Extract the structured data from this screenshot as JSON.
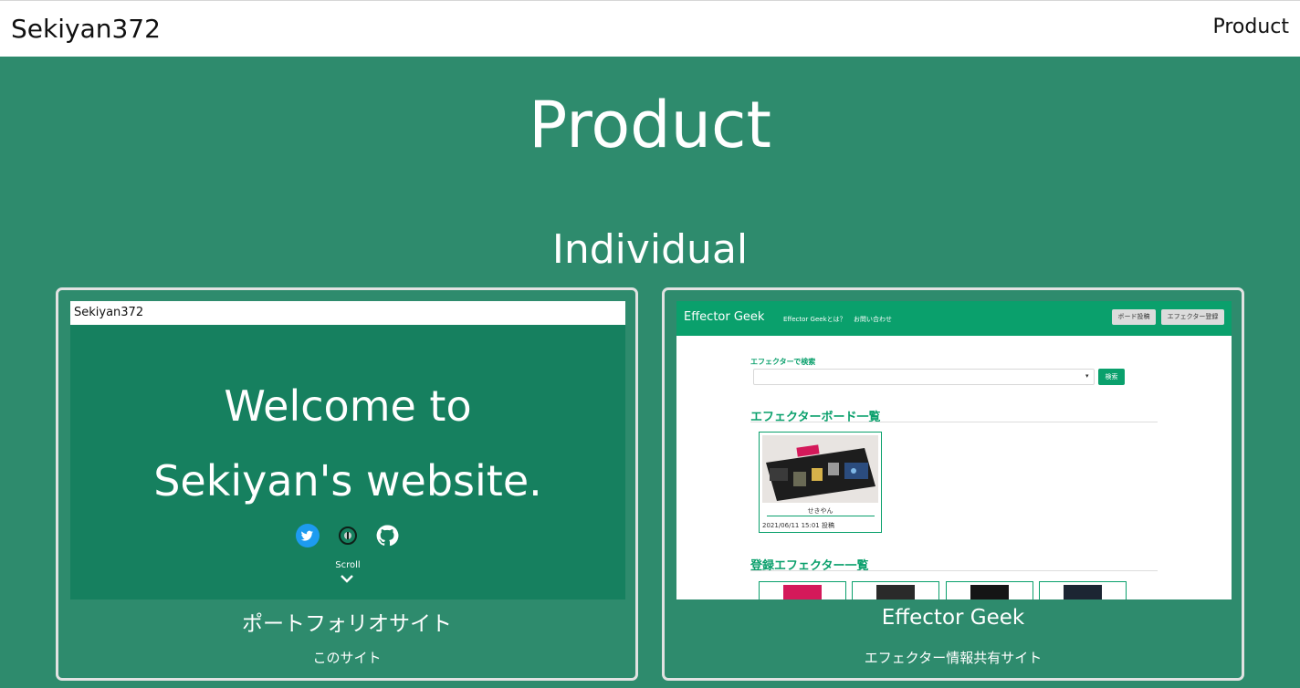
{
  "navbar": {
    "brand": "Sekiyan372",
    "link": "Product"
  },
  "page": {
    "title": "Product",
    "section": "Individual"
  },
  "cards": [
    {
      "title": "ポートフォリオサイト",
      "description": "このサイト",
      "thumbnail": {
        "brand": "Sekiyan372",
        "line1": "Welcome to",
        "line2": "Sekiyan's website.",
        "icons": [
          "twitter-icon",
          "qiita-icon",
          "github-icon"
        ],
        "scroll": "Scroll"
      }
    },
    {
      "title": "Effector Geek",
      "description": "エフェクター情報共有サイト",
      "thumbnail": {
        "brand": "Effector Geek",
        "nav": [
          "Effector Geekとは？",
          "お問い合わせ"
        ],
        "buttons": [
          "ボード投稿",
          "エフェクター登録"
        ],
        "search_label": "エフェクターで検索",
        "search_button": "検索",
        "boards_heading": "エフェクターボード一覧",
        "board_user": "せきやん",
        "board_date": "2021/06/11 15:01 投稿",
        "effectors_heading": "登録エフェクター一覧"
      }
    }
  ],
  "colors": {
    "page_bg": "#2e8b6d",
    "hero_bg": "#16805f",
    "accent": "#0aa06c",
    "card_border": "#e2e2e2"
  }
}
